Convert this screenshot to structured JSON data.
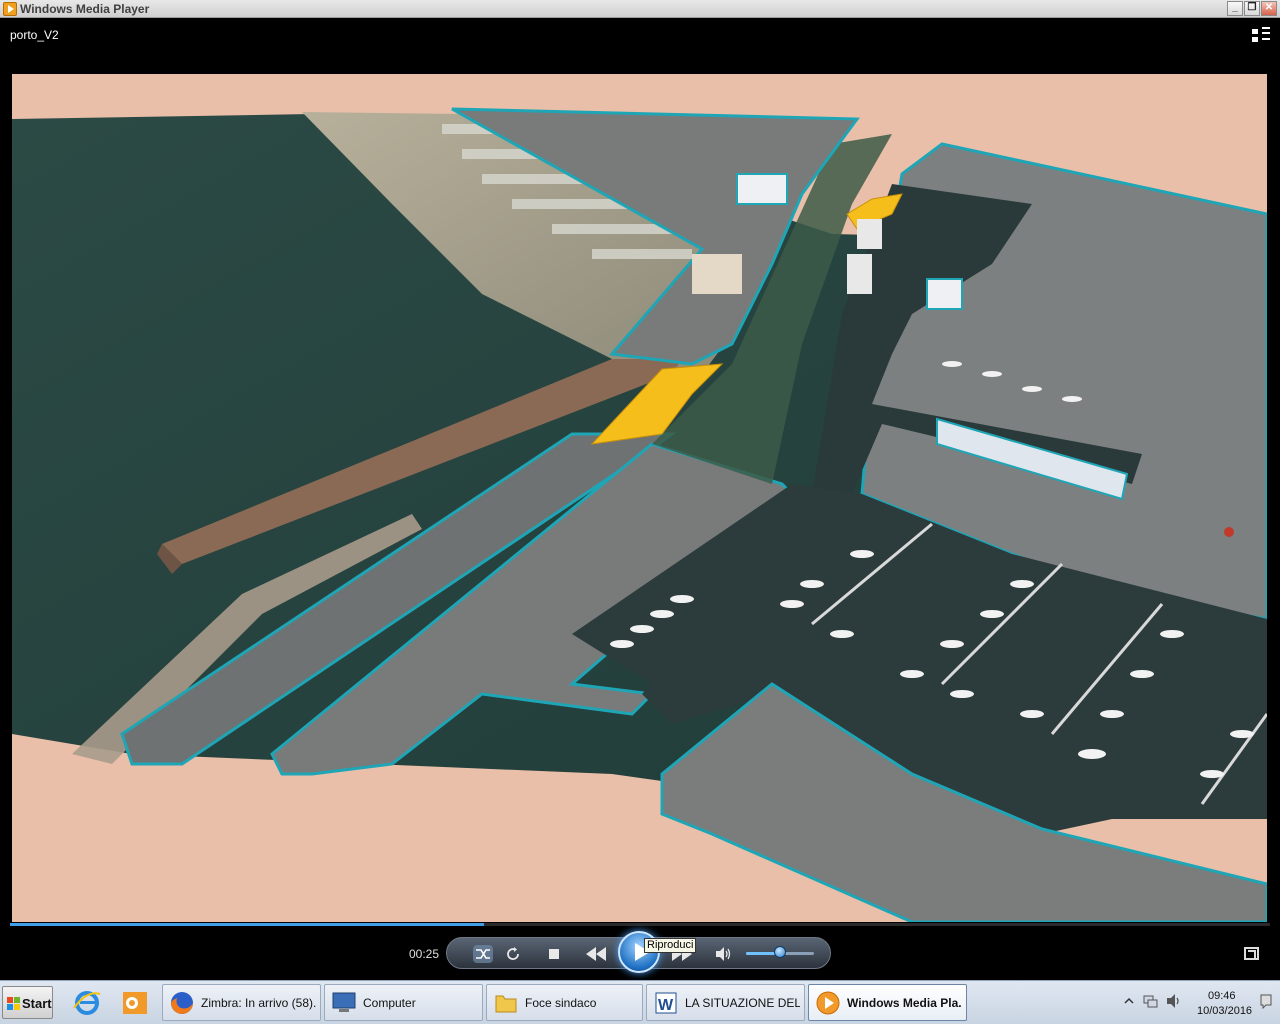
{
  "window": {
    "title": "Windows Media Player",
    "controls": {
      "minimize": "_",
      "restore": "❐",
      "close": "✕"
    }
  },
  "player": {
    "media_title": "porto_V2",
    "current_time": "00:25",
    "progress": 0.376,
    "volume": 0.5,
    "tooltip": "Riproduci",
    "colors": {
      "seek": "#3f9ee8",
      "accent": "#1e6fc2"
    },
    "icons": {
      "switch_view": "switch-to-library-icon",
      "shuffle": "shuffle-icon",
      "repeat": "repeat-icon",
      "stop": "stop-icon",
      "previous": "previous-icon",
      "play": "play-icon",
      "next": "next-icon",
      "mute": "speaker-icon",
      "fullscreen": "fullscreen-icon"
    }
  },
  "taskbar": {
    "start_label": "Start",
    "quick_launch": [
      "internet-explorer-icon",
      "outlook-icon"
    ],
    "tasks": [
      {
        "label": "Zimbra: In arrivo (58)...",
        "icon": "firefox-icon",
        "active": false
      },
      {
        "label": "Computer",
        "icon": "computer-icon",
        "active": false
      },
      {
        "label": "Foce sindaco",
        "icon": "folder-icon",
        "active": false
      },
      {
        "label": "LA SITUAZIONE DEL ...",
        "icon": "word-icon",
        "active": false
      },
      {
        "label": "Windows Media Pla...",
        "icon": "media-player-icon",
        "active": true
      }
    ],
    "clock": {
      "time": "09:46",
      "date": "10/03/2016"
    },
    "tray_icons": [
      "show-hidden-icons-icon",
      "network-icon",
      "volume-icon",
      "action-center-icon"
    ]
  }
}
